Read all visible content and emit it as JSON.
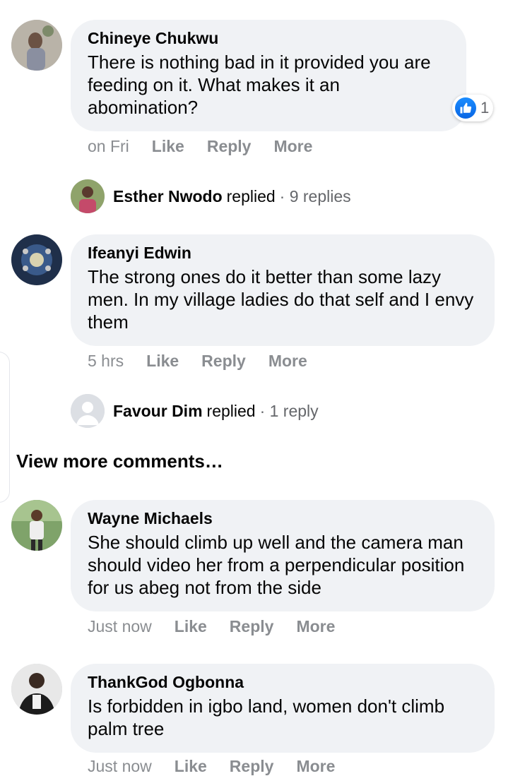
{
  "comments": [
    {
      "author": "Chineye Chukwu",
      "text": "There is nothing bad in it provided you are feeding on it. What makes it an abomination?",
      "timestamp": "on Fri",
      "reaction_count": "1",
      "replies": {
        "name": "Esther Nwodo",
        "verb": "replied",
        "count": "· 9 replies"
      }
    },
    {
      "author": "Ifeanyi Edwin",
      "text": "The strong ones do it better than some lazy men. In my village ladies do that self and I envy them",
      "timestamp": "5 hrs",
      "replies": {
        "name": "Favour Dim",
        "verb": "replied",
        "count": "· 1 reply"
      }
    },
    {
      "author": "Wayne Michaels",
      "text": "She should climb up well and the camera man should video her from a perpendicular position for us abeg not from the side",
      "timestamp": "Just now"
    },
    {
      "author": "ThankGod Ogbonna",
      "text": "Is forbidden in igbo land, women don't climb palm tree",
      "timestamp": "Just now"
    }
  ],
  "actions": {
    "like": "Like",
    "reply": "Reply",
    "more": "More"
  },
  "view_more": "View more comments…",
  "colors": {
    "bubble": "#f0f2f5",
    "meta": "#8a8d91",
    "like_blue": "#1877f2"
  }
}
